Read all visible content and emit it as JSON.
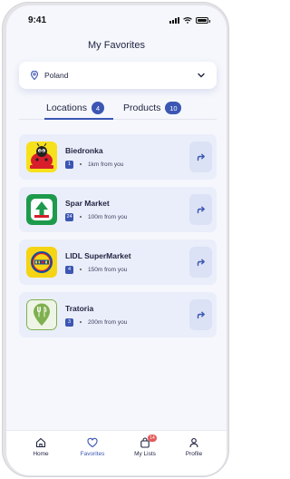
{
  "status": {
    "time": "9:41"
  },
  "header": {
    "title": "My Favorites"
  },
  "country_select": {
    "value": "Poland"
  },
  "tabs": [
    {
      "label": "Locations",
      "count": "4",
      "active": true
    },
    {
      "label": "Products",
      "count": "10",
      "active": false
    }
  ],
  "favorites": [
    {
      "name": "Biedronka",
      "count": "1",
      "distance": "1km from you",
      "logo": "biedronka-logo"
    },
    {
      "name": "Spar Market",
      "count": "24",
      "distance": "100m from you",
      "logo": "spar-logo"
    },
    {
      "name": "LIDL SuperMarket",
      "count": "4",
      "distance": "150m from you",
      "logo": "lidl-logo"
    },
    {
      "name": "Tratoria",
      "count": "3",
      "distance": "200m from you",
      "logo": "restaurant-pin-logo"
    }
  ],
  "nav": {
    "home": "Home",
    "favorites": "Favorites",
    "lists": "My Lists",
    "lists_badge": "14",
    "profile": "Profile"
  },
  "colors": {
    "accent": "#3b56b3",
    "card": "#eaeefa",
    "badge_red": "#e35a5a"
  }
}
